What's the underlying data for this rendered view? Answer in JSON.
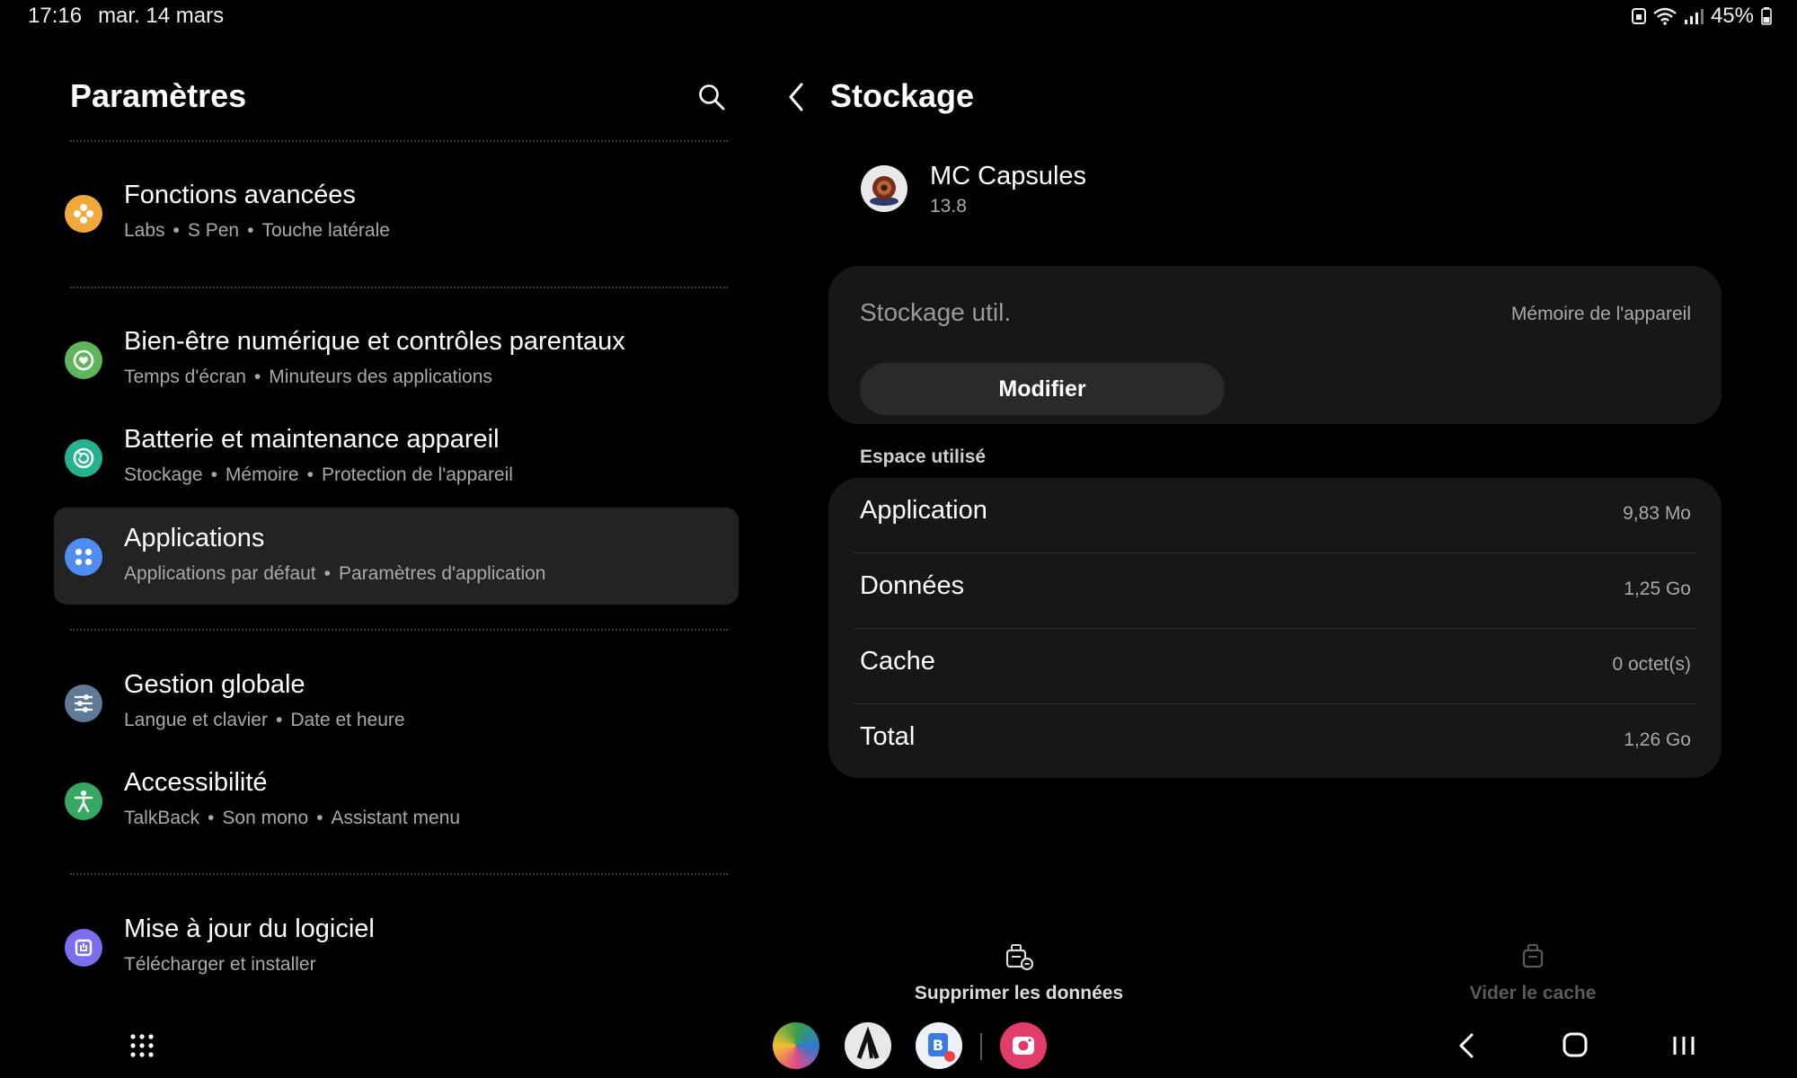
{
  "status_bar": {
    "time": "17:16",
    "date": "mar. 14 mars",
    "battery": "45%"
  },
  "left_pane": {
    "title": "Paramètres",
    "items": [
      {
        "title": "Fonctions avancées",
        "subtitle": [
          "Labs",
          "S Pen",
          "Touche latérale"
        ],
        "icon": "star-cog-icon",
        "color": "#f2a93b"
      },
      {
        "title": "Bien-être numérique et contrôles parentaux",
        "subtitle": [
          "Temps d'écran",
          "Minuteurs des applications"
        ],
        "icon": "heart-circle-icon",
        "color": "#5fb65a"
      },
      {
        "title": "Batterie et maintenance appareil",
        "subtitle": [
          "Stockage",
          "Mémoire",
          "Protection de l'appareil"
        ],
        "icon": "refresh-circle-icon",
        "color": "#25b38f"
      },
      {
        "title": "Applications",
        "subtitle": [
          "Applications par défaut",
          "Paramètres d'application"
        ],
        "icon": "grid-dots-icon",
        "color": "#4f8df2"
      },
      {
        "title": "Gestion globale",
        "subtitle": [
          "Langue et clavier",
          "Date et heure"
        ],
        "icon": "sliders-icon",
        "color": "#5f7a96"
      },
      {
        "title": "Accessibilité",
        "subtitle": [
          "TalkBack",
          "Son mono",
          "Assistant menu"
        ],
        "icon": "accessibility-icon",
        "color": "#37a861"
      },
      {
        "title": "Mise à jour du logiciel",
        "subtitle": [
          "Télécharger et installer"
        ],
        "icon": "update-icon",
        "color": "#7b6ff0"
      }
    ]
  },
  "right_pane": {
    "title": "Stockage",
    "app": {
      "name": "MC Capsules",
      "version": "13.8"
    },
    "storage_used_label": "Stockage util.",
    "storage_location": "Mémoire de l'appareil",
    "modify_button": "Modifier",
    "section_label": "Espace utilisé",
    "rows": [
      {
        "label": "Application",
        "value": "9,83 Mo"
      },
      {
        "label": "Données",
        "value": "1,25 Go"
      },
      {
        "label": "Cache",
        "value": "0 octet(s)"
      },
      {
        "label": "Total",
        "value": "1,26 Go"
      }
    ],
    "actions": {
      "clear_data": "Supprimer les données",
      "clear_cache": "Vider le cache"
    }
  },
  "colors": {
    "selected_background": "#232323",
    "card_background": "#171717",
    "disabled_text": "#5a5a5a"
  }
}
